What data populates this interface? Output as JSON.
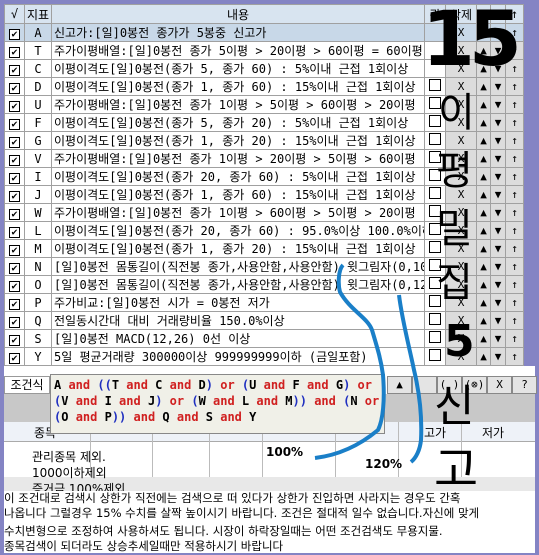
{
  "grid": {
    "headers": [
      "√",
      "지표",
      "내용",
      "관",
      "삭제",
      "▲",
      "▼",
      "↑"
    ],
    "delete_label": "X",
    "up_label": "▲",
    "down_label": "▼",
    "top_label": "↑",
    "rows": [
      {
        "id": "A",
        "content": "신고가:[일]0봉전 종가가 5봉중 신고가",
        "checked": true,
        "selected": true
      },
      {
        "id": "T",
        "content": "주가이평배열:[일]0봉전 종가 5이평 > 20이평 > 60이평 = 60이평",
        "checked": true
      },
      {
        "id": "C",
        "content": "이평이격도[일]0봉전(종가 5, 종가 60) : 5%이내 근접 1회이상",
        "checked": true
      },
      {
        "id": "D",
        "content": "이평이격도[일]0봉전(종가 1, 종가 60) : 15%이내 근접 1회이상",
        "checked": true
      },
      {
        "id": "U",
        "content": "주가이평배열:[일]0봉전 종가 1이평 > 5이평 > 60이평 > 20이평",
        "checked": true
      },
      {
        "id": "F",
        "content": "이평이격도[일]0봉전(종가 5, 종가 20) : 5%이내 근접 1회이상",
        "checked": true
      },
      {
        "id": "G",
        "content": "이평이격도[일]0봉전(종가 1, 종가 20) : 15%이내 근접 1회이상",
        "checked": true
      },
      {
        "id": "V",
        "content": "주가이평배열:[일]0봉전 종가 1이평 > 20이평 > 5이평 > 60이평",
        "checked": true
      },
      {
        "id": "I",
        "content": "이평이격도[일]0봉전(종가 20, 종가 60) : 5%이내 근접 1회이상",
        "checked": true
      },
      {
        "id": "J",
        "content": "이평이격도[일]0봉전(종가 1, 종가 60) : 15%이내 근접 1회이상",
        "checked": true
      },
      {
        "id": "W",
        "content": "주가이평배열:[일]0봉전 종가 1이평 > 60이평 > 5이평 > 20이평",
        "checked": true
      },
      {
        "id": "L",
        "content": "이평이격도[일]0봉전(종가 20, 종가 60) : 95.0%이상 100.0%이하 1회",
        "checked": true
      },
      {
        "id": "M",
        "content": "이평이격도[일]0봉전(종가 1, 종가 20) : 15%이내 근접 1회이상",
        "checked": true
      },
      {
        "id": "N",
        "content": "[일]0봉전 몸통길이(직전봉 종가,사용안함,사용안함) 윗그림자(0,10",
        "checked": true
      },
      {
        "id": "O",
        "content": "[일]0봉전 몸통길이(직전봉 종가,사용안함,사용안함) 윗그림자(0,12",
        "checked": true
      },
      {
        "id": "P",
        "content": "주가비교:[일]0봉전 시가 = 0봉전 저가",
        "checked": true
      },
      {
        "id": "Q",
        "content": "전일동시간대 대비 거래량비율 150.0%이상",
        "checked": true
      },
      {
        "id": "S",
        "content": "[일]0봉전 MACD(12,26) 0선 이상",
        "checked": true
      },
      {
        "id": "Y",
        "content": "5일 평균거래량 300000이상 999999999이하 (금일포함)",
        "checked": true
      }
    ]
  },
  "formula": {
    "label": "조건식",
    "tokens": [
      [
        "A",
        "id"
      ],
      [
        " and ",
        "op"
      ],
      [
        "((",
        "par"
      ],
      [
        "T",
        "id"
      ],
      [
        " and ",
        "op"
      ],
      [
        "C",
        "id"
      ],
      [
        " and ",
        "op"
      ],
      [
        "D",
        "id"
      ],
      [
        ")",
        "par"
      ],
      [
        " or ",
        "op"
      ],
      [
        "(",
        "par"
      ],
      [
        "U",
        "id"
      ],
      [
        " and ",
        "op"
      ],
      [
        "F",
        "id"
      ],
      [
        " and ",
        "op"
      ],
      [
        "G",
        "id"
      ],
      [
        ")",
        "par"
      ],
      [
        " or ",
        "op"
      ],
      [
        "(",
        "par"
      ],
      [
        "V",
        "id"
      ],
      [
        " and ",
        "op"
      ],
      [
        "I",
        "id"
      ],
      [
        " and ",
        "op"
      ],
      [
        "J",
        "id"
      ],
      [
        ")",
        "par"
      ],
      [
        " or ",
        "op"
      ],
      [
        "(",
        "par"
      ],
      [
        "W",
        "id"
      ],
      [
        " and ",
        "op"
      ],
      [
        "L",
        "id"
      ],
      [
        " and ",
        "op"
      ],
      [
        "M",
        "id"
      ],
      [
        "))",
        "par"
      ],
      [
        " and ",
        "op"
      ],
      [
        "(",
        "par"
      ],
      [
        "N",
        "id"
      ],
      [
        " or ",
        "op"
      ],
      [
        "(",
        "par"
      ],
      [
        "O",
        "id"
      ],
      [
        " and ",
        "op"
      ],
      [
        "P",
        "id"
      ],
      [
        "))",
        "par"
      ],
      [
        " and ",
        "op"
      ],
      [
        "Q",
        "id"
      ],
      [
        " and ",
        "op"
      ],
      [
        "S",
        "id"
      ],
      [
        " and ",
        "op"
      ],
      [
        "Y",
        "id"
      ]
    ],
    "buttons": [
      "▲",
      "",
      "( )",
      "(⊗)",
      "X",
      "?"
    ]
  },
  "results": {
    "headers": [
      "종목",
      "고가",
      "저가"
    ],
    "memo": [
      "관리종목 제외.",
      "1000이하제외",
      "증거금 100%제외"
    ],
    "pct1": "100%",
    "pct2": "120%"
  },
  "notes": [
    "이 조건대로 검색시 상한가 직전에는 검색으로 떠 있다가 상한가 진입하면 사라지는  경우도 간혹",
    "나옵니다 그럴경우 15% 수치를 살짝 높이시기 바랍니다. 조건은 절대적 일수 없습니다.자신에 맞게",
    "수치변형으로 조정하여 사용하셔도 됩니다. 시장이 하락장일때는 어떤 조건검색도 무용지물.",
    "종목검색이 되더라도 상승추세일때만 적용하시기 바랍니다"
  ],
  "annotations": {
    "count": "15",
    "vertical": [
      "이",
      "평",
      "밀",
      "집"
    ],
    "count2": "5",
    "vertical2": [
      "신",
      "고"
    ],
    "pen_color": "#1a7fc8"
  }
}
